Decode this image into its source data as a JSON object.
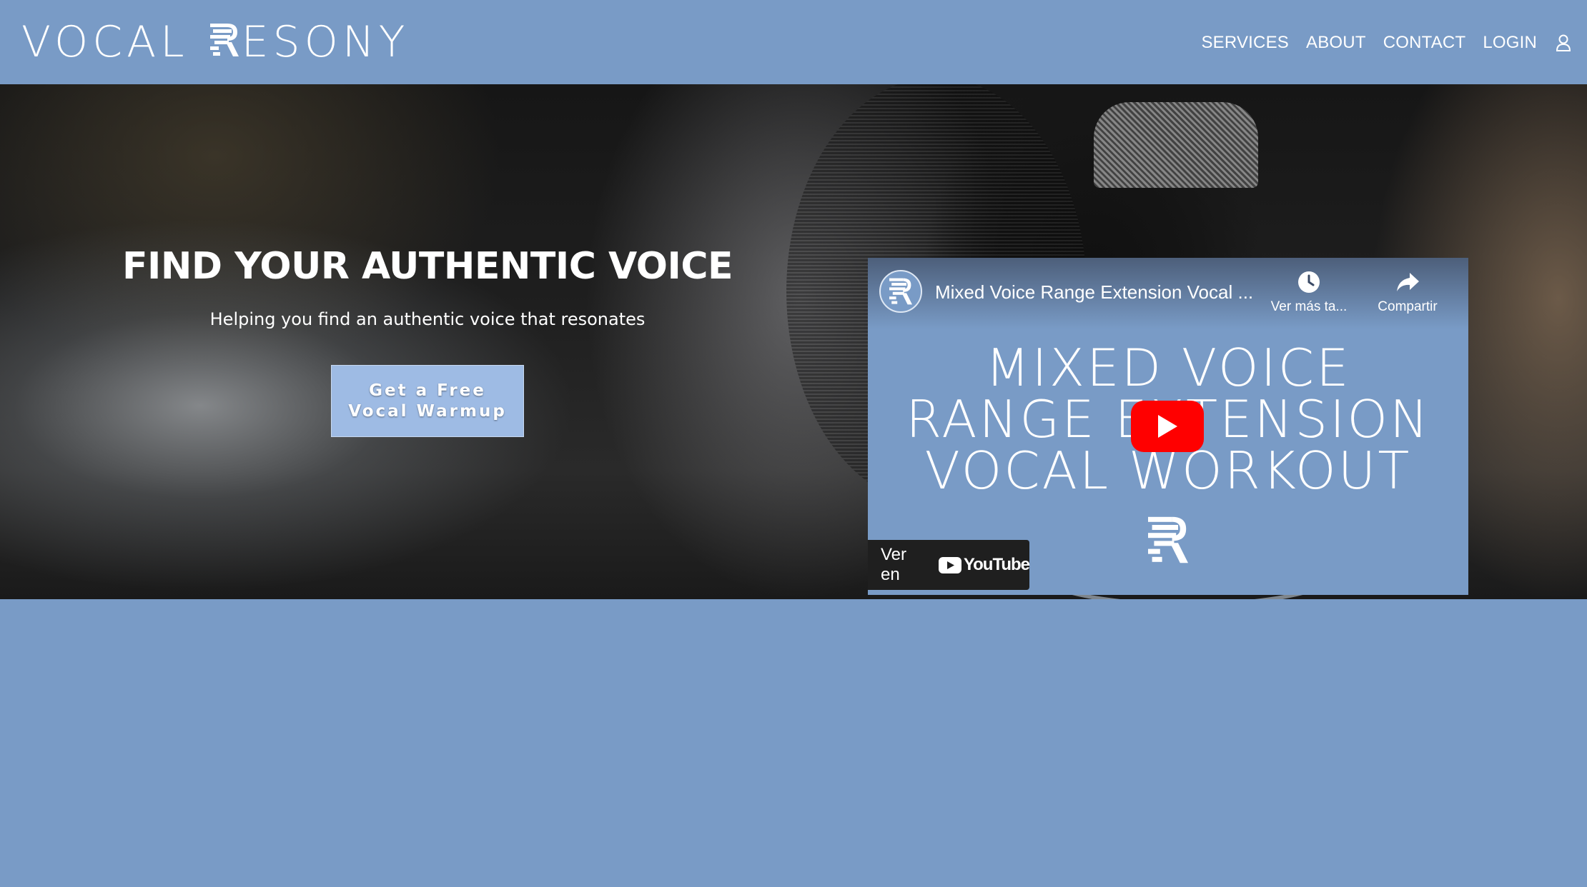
{
  "header": {
    "logo_left": "VOCAL",
    "logo_right": "ESONY",
    "nav": [
      "SERVICES",
      "ABOUT",
      "CONTACT",
      "LOGIN"
    ],
    "user_icon": "user-icon"
  },
  "hero": {
    "title": "FIND YOUR AUTHENTIC VOICE",
    "subtitle": "Helping you find an authentic voice that resonates",
    "cta_label": "Get a Free Vocal Warmup"
  },
  "video": {
    "title": "Mixed Voice Range Extension Vocal ...",
    "actions": [
      {
        "label": "Ver más ta...",
        "icon": "clock-icon"
      },
      {
        "label": "Compartir",
        "icon": "share-icon"
      }
    ],
    "thumbnail_lines": [
      "MIXED VOICE",
      "RANGE EXTENSION",
      "VOCAL WORKOUT"
    ],
    "watch_on_label": "Ver en",
    "youtube_word": "YouTube"
  },
  "colors": {
    "brand_blue": "#799bc6",
    "cta_blue": "#9ebbe4",
    "youtube_red": "#ff0000"
  }
}
